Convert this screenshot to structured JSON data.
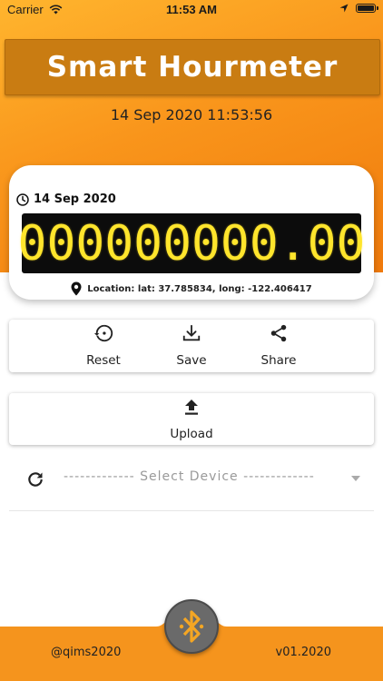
{
  "status_bar": {
    "carrier": "Carrier",
    "time": "11:53 AM",
    "wifi_icon": "wifi-icon",
    "location_icon": "location-arrow-icon",
    "battery_icon": "battery-icon"
  },
  "header": {
    "title": "Smart Hourmeter",
    "datetime": "14 Sep 2020 11:53:56"
  },
  "meter": {
    "date": "14 Sep 2020",
    "reading": "000000000.00",
    "location": "Location: lat: 37.785834, long: -122.406417"
  },
  "actions": {
    "reset_label": "Reset",
    "save_label": "Save",
    "share_label": "Share",
    "upload_label": "Upload"
  },
  "device": {
    "placeholder": "------------- Select Device -------------"
  },
  "footer": {
    "handle": "@qims2020",
    "version": "v01.2020"
  },
  "colors": {
    "accent": "#f5941d",
    "title_bg": "#c97c12",
    "lcd_digits": "#ffe52c",
    "bluetooth": "#f5a623"
  }
}
